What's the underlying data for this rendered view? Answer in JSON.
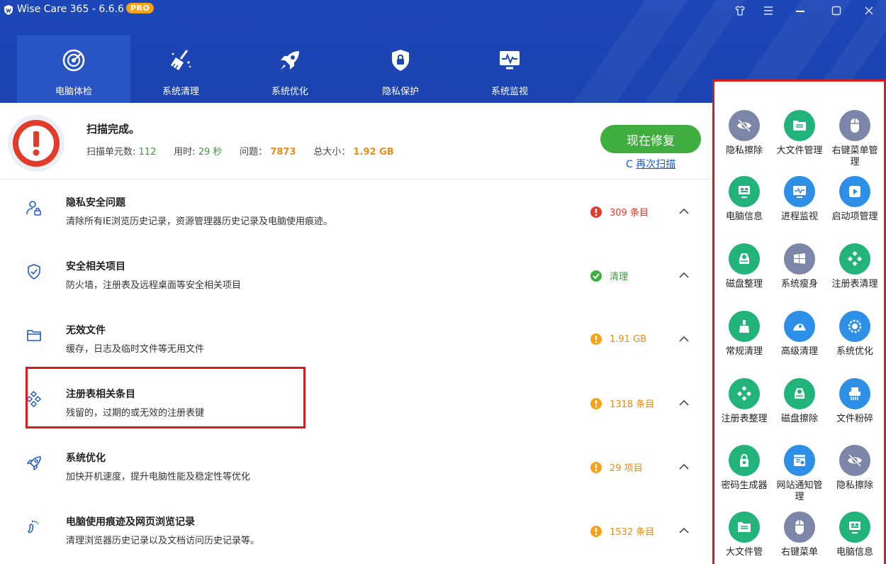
{
  "app": {
    "title": "Wise Care 365 - 6.6.6",
    "badge": "PRO"
  },
  "nav": {
    "tabs": [
      {
        "label": "电脑体检",
        "icon": "radar-icon"
      },
      {
        "label": "系统清理",
        "icon": "broom-icon"
      },
      {
        "label": "系统优化",
        "icon": "rocket-icon"
      },
      {
        "label": "隐私保护",
        "icon": "shield-lock-icon"
      },
      {
        "label": "系统监视",
        "icon": "monitor-pulse-icon"
      }
    ]
  },
  "summary": {
    "title": "扫描完成。",
    "units_label": "扫描单元数:",
    "units_value": "112",
    "time_label": "用时:",
    "time_value": "29 秒",
    "issues_label": "问题：",
    "issues_value": "7873",
    "size_label": "总大小：",
    "size_value": "1.92 GB",
    "fix_button": "现在修复",
    "rescan_icon": "C",
    "rescan": "再次扫描"
  },
  "items": [
    {
      "title": "隐私安全问题",
      "desc": "清除所有IE浏览历史记录，资源管理器历史记录及电脑使用痕迹。",
      "status": "309 条目",
      "level": "error"
    },
    {
      "title": "安全相关项目",
      "desc": "防火墙，注册表及远程桌面等安全相关项目",
      "status": "清理",
      "level": "ok"
    },
    {
      "title": "无效文件",
      "desc": "缓存，日志及临时文件等无用文件",
      "status": "1.91 GB",
      "level": "warn"
    },
    {
      "title": "注册表相关条目",
      "desc": "残留的，过期的或无效的注册表键",
      "status": "1318 条目",
      "level": "warn"
    },
    {
      "title": "系统优化",
      "desc": "加快开机速度，提升电脑性能及稳定性等优化",
      "status": "29 项目",
      "level": "warn"
    },
    {
      "title": "电脑使用痕迹及网页浏览记录",
      "desc": "清理浏览器历史记录以及文档访问历史记录等。",
      "status": "1532 条目",
      "level": "warn"
    }
  ],
  "tools": [
    {
      "label": "隐私擦除",
      "color": "#7b86a8"
    },
    {
      "label": "大文件管理",
      "color": "#22b37a"
    },
    {
      "label": "右键菜单管理",
      "color": "#7b86a8"
    },
    {
      "label": "电脑信息",
      "color": "#22b37a"
    },
    {
      "label": "进程监视",
      "color": "#2d8fe6"
    },
    {
      "label": "启动项管理",
      "color": "#2d8fe6"
    },
    {
      "label": "磁盘整理",
      "color": "#22b37a"
    },
    {
      "label": "系统瘦身",
      "color": "#7b86a8"
    },
    {
      "label": "注册表清理",
      "color": "#22b37a"
    },
    {
      "label": "常规清理",
      "color": "#22b37a"
    },
    {
      "label": "高级清理",
      "color": "#2d8fe6"
    },
    {
      "label": "系统优化",
      "color": "#2d8fe6"
    },
    {
      "label": "注册表整理",
      "color": "#22b37a"
    },
    {
      "label": "磁盘擦除",
      "color": "#22b37a"
    },
    {
      "label": "文件粉碎",
      "color": "#2d8fe6"
    },
    {
      "label": "密码生成器",
      "color": "#22b37a"
    },
    {
      "label": "网站通知管理",
      "color": "#2d8fe6"
    },
    {
      "label": "隐私擦除",
      "color": "#7b86a8"
    },
    {
      "label": "大文件管",
      "color": "#22b37a"
    },
    {
      "label": "右键菜单",
      "color": "#7b86a8"
    },
    {
      "label": "电脑信息",
      "color": "#22b37a"
    }
  ]
}
